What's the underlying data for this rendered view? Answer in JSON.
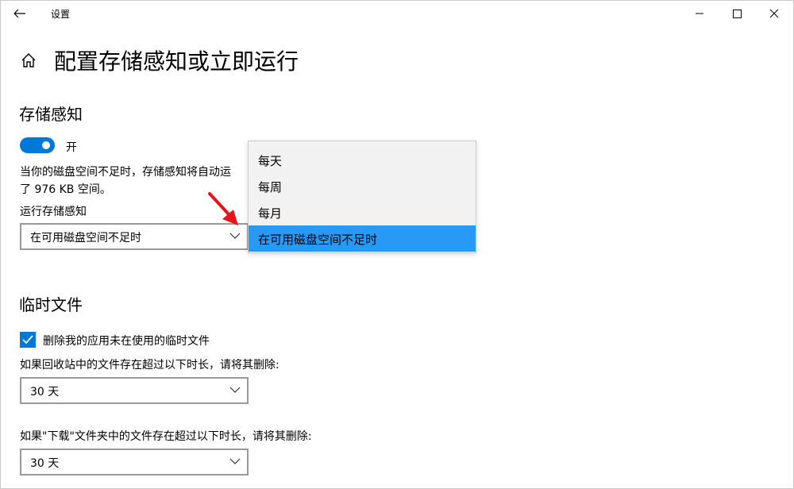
{
  "window": {
    "title": "设置",
    "icons": {
      "back": "back-arrow-icon",
      "minimize": "minimize-icon",
      "maximize": "maximize-icon",
      "close": "close-icon"
    }
  },
  "page": {
    "title": "配置存储感知或立即运行",
    "home_icon": "home-icon"
  },
  "storage_sense": {
    "heading": "存储感知",
    "toggle": {
      "state": "on",
      "label": "开"
    },
    "description_line1": "当你的磁盘空间不足时，存储感知将自动运",
    "description_line2": "了 976 KB 空间。",
    "run_label": "运行存储感知",
    "run_select_value": "在可用磁盘空间不足时",
    "dropdown_options": [
      "每天",
      "每周",
      "每月",
      "在可用磁盘空间不足时"
    ],
    "selected_option_index": 3
  },
  "temp_files": {
    "heading": "临时文件",
    "checkbox": {
      "checked": true,
      "label": "删除我的应用未在使用的临时文件"
    },
    "recycle_label": "如果回收站中的文件存在超过以下时长，请将其删除:",
    "recycle_value": "30 天",
    "download_label": "如果\"下载\"文件夹中的文件存在超过以下时长，请将其删除:",
    "download_value": "30 天"
  },
  "colors": {
    "accent": "#0078d7",
    "highlight": "#2899f5",
    "annotation_arrow": "#e8141b"
  }
}
